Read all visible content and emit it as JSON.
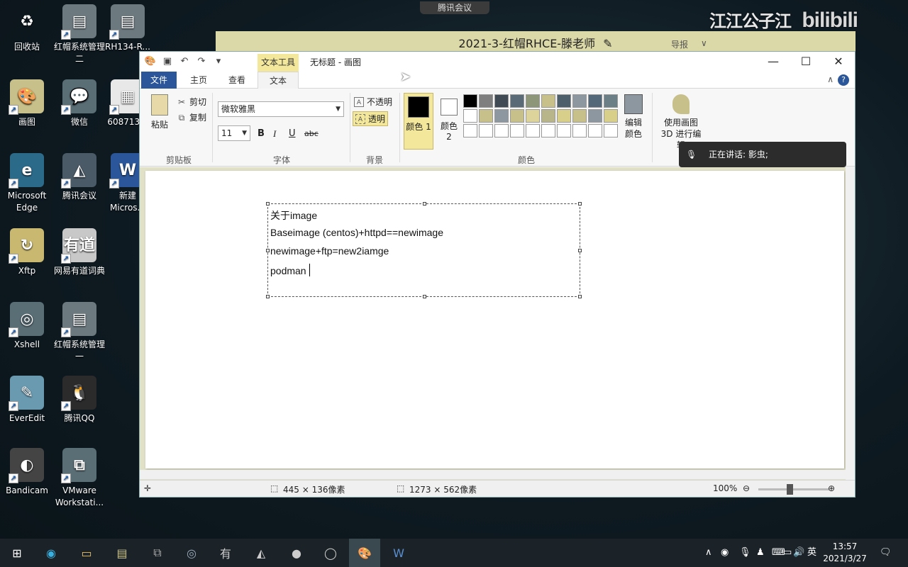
{
  "desktop_icons": [
    {
      "label": "回收站",
      "icon": "recycle-bin-icon"
    },
    {
      "label": "红帽系统管理二",
      "icon": "book-icon"
    },
    {
      "label": "RH134-R...",
      "icon": "book-icon"
    },
    {
      "label": "画图",
      "icon": "paint-icon"
    },
    {
      "label": "微信",
      "icon": "wechat-icon"
    },
    {
      "label": "608713...",
      "icon": "file-icon"
    },
    {
      "label": "Microsoft Edge",
      "icon": "edge-icon"
    },
    {
      "label": "腾讯会议",
      "icon": "tencent-meeting-icon"
    },
    {
      "label": "新建 Micros...",
      "icon": "word-icon"
    },
    {
      "label": "Xftp",
      "icon": "xftp-icon"
    },
    {
      "label": "网易有道词典",
      "icon": "youdao-icon"
    },
    {
      "label": "Xshell",
      "icon": "xshell-icon"
    },
    {
      "label": "红帽系统管理一",
      "icon": "book-icon"
    },
    {
      "label": "EverEdit",
      "icon": "everedit-icon"
    },
    {
      "label": "腾讯QQ",
      "icon": "qq-icon"
    },
    {
      "label": "Bandicam",
      "icon": "bandicam-icon"
    },
    {
      "label": "VMware Workstati...",
      "icon": "vmware-icon"
    }
  ],
  "meeting": {
    "tab_label": "腾讯会议",
    "title": "2021-3-红帽RHCE-滕老师",
    "brand": "江江公子江",
    "brand2": "bilibili",
    "right_label": "导报"
  },
  "paint": {
    "context_tab": "文本工具",
    "title": "无标题 - 画图",
    "tabs": [
      "文件",
      "主页",
      "查看",
      "文本"
    ],
    "clipboard": {
      "paste": "粘贴",
      "cut": "剪切",
      "copy": "复制",
      "group": "剪贴板"
    },
    "font": {
      "family": "微软雅黑",
      "size": "11",
      "group": "字体"
    },
    "background": {
      "opaque": "不透明",
      "transparent": "透明",
      "group": "背景"
    },
    "colors": {
      "color1": "颜色 1",
      "color2": "颜色 2",
      "edit": "编辑颜色",
      "group": "颜色"
    },
    "paint3d": "使用画图 3D 进行编辑",
    "text_lines": [
      "关于image",
      "Baseimage (centos)+httpd==newimage",
      "newimage+ftp=new2iamge",
      "podman"
    ],
    "status": {
      "selection": "445 × 136像素",
      "canvas": "1273 × 562像素",
      "zoom": "100%"
    }
  },
  "toast": {
    "text": "正在讲话: 影虫;"
  },
  "taskbar": {
    "ime": "英",
    "time": "13:57",
    "date": "2021/3/27"
  },
  "swatch_colors": [
    "#000000",
    "#7f7f7f",
    "#3f4a55",
    "#5a6b77",
    "#8d9678",
    "#c8c08a",
    "#4e5f6c",
    "#8c97a0",
    "#536878",
    "#6d7f86",
    "#ffffff",
    "#c8c08a",
    "#8c97a0",
    "#c8c08a",
    "#dcd49a",
    "#b9b58a",
    "#d8cf8a",
    "#c8c08a",
    "#8c97a0",
    "#d8cf8a",
    "#ffffff",
    "#ffffff",
    "#ffffff",
    "#ffffff",
    "#ffffff",
    "#ffffff",
    "#ffffff",
    "#ffffff",
    "#ffffff",
    "#ffffff"
  ]
}
